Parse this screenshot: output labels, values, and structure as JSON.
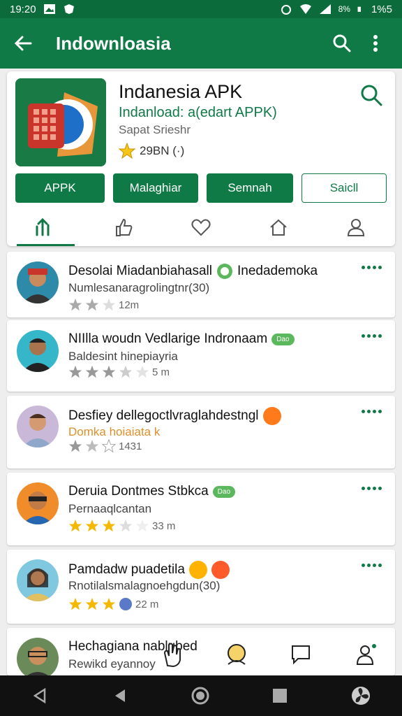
{
  "status_bar": {
    "time": "19:20",
    "battery": "8%",
    "time_right": "1%5"
  },
  "app_bar": {
    "title": "Indownloasia"
  },
  "app": {
    "name": "Indanesia APK",
    "subtitle": "Indanload: a(edart APPK)",
    "developer": "Sapat Srieshr",
    "rating_text": "29BN (·)"
  },
  "buttons": [
    {
      "label": "APPK",
      "style": "green"
    },
    {
      "label": "Malaghiar",
      "style": "green"
    },
    {
      "label": "Semnah",
      "style": "green"
    },
    {
      "label": "Saicll",
      "style": "outline"
    }
  ],
  "tabs": [
    {
      "icon": "trending-icon",
      "active": true
    },
    {
      "icon": "thumbs-icon",
      "active": false
    },
    {
      "icon": "heart-icon",
      "active": false
    },
    {
      "icon": "home-icon",
      "active": false
    },
    {
      "icon": "profile-icon",
      "active": false
    }
  ],
  "posts": [
    {
      "name": "Desolai Miadanbiahasall",
      "badge": "Inedademoka",
      "line": "Numlesanaragrolingtnr(30)",
      "rating": 2,
      "meta": "12m",
      "style": "normal"
    },
    {
      "name": "NIIlla woudn Vedlarige Indronaam",
      "badge": "Dao",
      "line": "Baldesint hinepiayria",
      "rating": 3.5,
      "meta": "5 m",
      "style": "normal"
    },
    {
      "name": "Desfiey dellegoctlvraglahdestngl",
      "badge": "",
      "line": "Domka hoiaiata k",
      "rating": 1.5,
      "meta": "1431",
      "style": "orange"
    },
    {
      "name": "Deruia Dontmes Stbkca",
      "badge": "Dao",
      "line": "Pernaaqlcantan",
      "rating": 3,
      "meta": "33 m",
      "style": "normal"
    },
    {
      "name": "Pamdadw puadetila",
      "badge": "",
      "line": "Rnotilalsmalagnoehgdun(30)",
      "rating": 3,
      "meta": "22 m",
      "style": "normal"
    },
    {
      "name": "Hechagiana nablubed",
      "badge": "",
      "line": "Rewikd eyannoy",
      "rating": 0,
      "meta": "",
      "style": "normal"
    }
  ]
}
